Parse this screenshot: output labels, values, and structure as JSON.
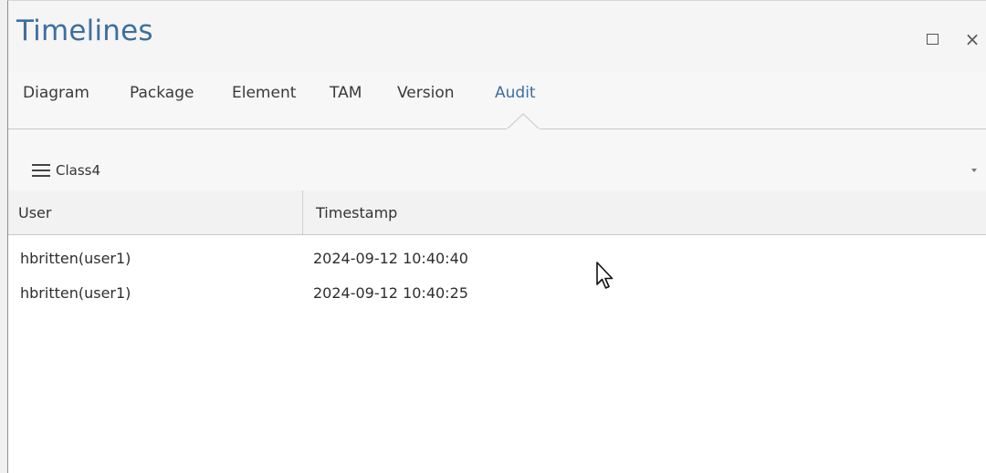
{
  "window": {
    "title": "Timelines"
  },
  "tabs": [
    {
      "label": "Diagram",
      "active": false
    },
    {
      "label": "Package",
      "active": false
    },
    {
      "label": "Element",
      "active": false
    },
    {
      "label": "TAM",
      "active": false
    },
    {
      "label": "Version",
      "active": false
    },
    {
      "label": "Audit",
      "active": true
    }
  ],
  "toolbar": {
    "menu_icon": "hamburger-icon",
    "element_name": "Class4",
    "dropdown_icon": "chevron-down-icon"
  },
  "table": {
    "columns": [
      "User",
      "Timestamp"
    ],
    "rows": [
      {
        "user": "hbritten(user1)",
        "timestamp": "2024-09-12 10:40:40"
      },
      {
        "user": "hbritten(user1)",
        "timestamp": "2024-09-12 10:40:25"
      }
    ]
  },
  "colors": {
    "accent": "#3d6f9e",
    "text": "#333333",
    "header_bg": "#f2f2f2"
  }
}
